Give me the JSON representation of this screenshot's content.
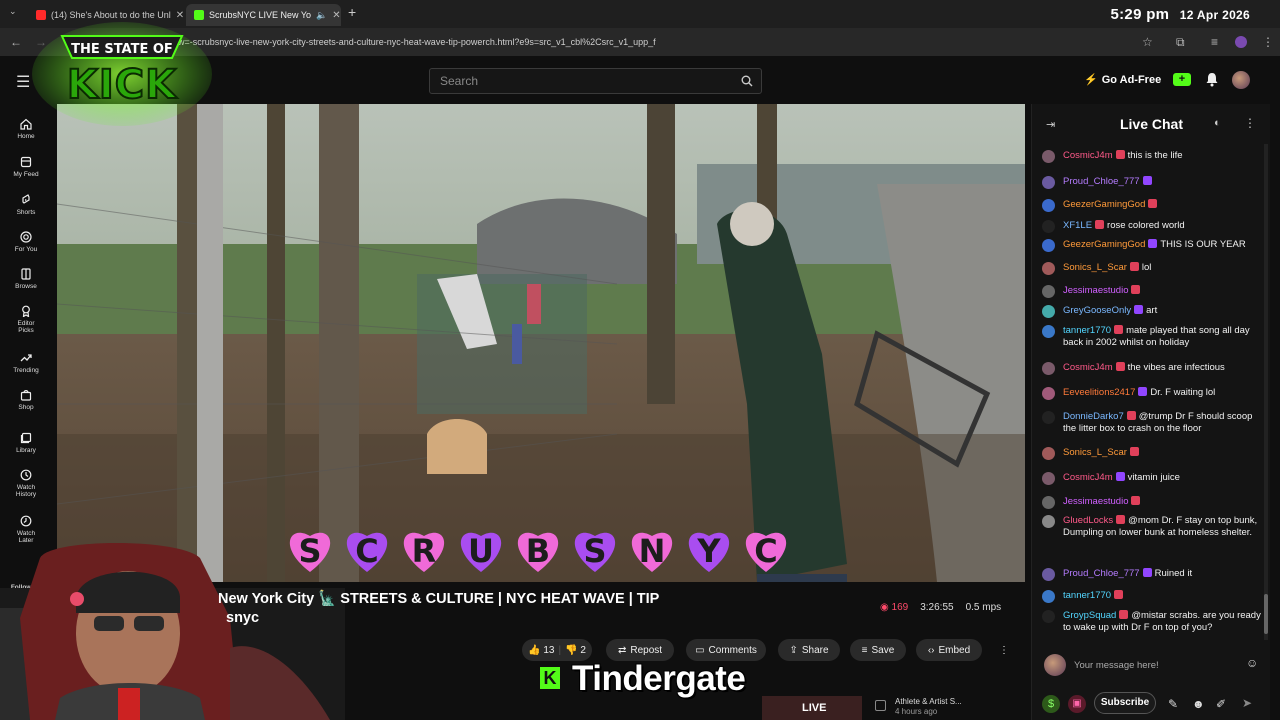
{
  "browser": {
    "tabs": [
      {
        "title": "(14) She's About to do the Unl",
        "favicon_color": "#ff2a2a"
      },
      {
        "title": "ScrubsNYC LIVE New Yo",
        "favicon_color": "#53fc18"
      }
    ],
    "clock_time": "5:29 pm",
    "clock_date": "12 Apr 2026",
    "url": "rw=-scrubsnyc-live-new-york-city-streets-and-culture-nyc-heat-wave-tip-powerch.html?e9s=src_v1_cbl%2Csrc_v1_upp_f"
  },
  "header": {
    "search_placeholder": "Search",
    "go_ad_free": "Go Ad-Free",
    "logo_line1": "THE STATE OF",
    "logo_line2": "KICK"
  },
  "sidebar": {
    "items": [
      {
        "label": "Home",
        "icon": "home-icon"
      },
      {
        "label": "My Feed",
        "icon": "feed-icon"
      },
      {
        "label": "Shorts",
        "icon": "shorts-icon"
      },
      {
        "label": "For You",
        "icon": "target-icon"
      },
      {
        "label": "Browse",
        "icon": "browse-icon"
      },
      {
        "label": "Editor Picks",
        "icon": "award-icon"
      },
      {
        "label": "Trending",
        "icon": "trending-icon"
      },
      {
        "label": "Shop",
        "icon": "shop-icon"
      },
      {
        "label": "Library",
        "icon": "library-icon"
      },
      {
        "label": "Watch History",
        "icon": "history-icon"
      },
      {
        "label": "Watch Later",
        "icon": "clock-icon"
      }
    ],
    "following_label": "Following"
  },
  "video": {
    "overlay_text": "SCRUBSNYC",
    "title_line1": "New York City 🗽 STREETS & CULTURE | NYC HEAT WAVE | TIP",
    "title_line2": "snyc",
    "viewers": "169",
    "duration": "3:26:55",
    "bitrate": "0.5 mps",
    "likes": "13",
    "dislikes": "2",
    "actions": [
      "Repost",
      "Comments",
      "Share",
      "Save",
      "Embed"
    ],
    "ticker_text": "Tindergate",
    "suggestion_title": "Athlete & Artist S...",
    "suggestion_time": "4 hours ago"
  },
  "chat": {
    "title": "Live Chat",
    "input_placeholder": "Your message here!",
    "subscribe_label": "Subscribe",
    "messages": [
      {
        "user": "CosmicJ4m",
        "color": "#ff5a8a",
        "text": "this is the life",
        "avatar": "#7a5a6a"
      },
      {
        "user": "Proud_Chloe_777",
        "color": "#b57cff",
        "text": "",
        "avatar": "#6a5aa0"
      },
      {
        "user": "GeezerGamingGod",
        "color": "#ff9a3a",
        "text": "",
        "avatar": "#3a6acc"
      },
      {
        "user": "XF1LE",
        "color": "#7ab8ff",
        "text": "rose colored world",
        "avatar": "#222"
      },
      {
        "user": "GeezerGamingGod",
        "color": "#ff9a3a",
        "text": "THIS IS OUR YEAR",
        "avatar": "#3a6acc"
      },
      {
        "user": "Sonics_L_Scar",
        "color": "#ff9a3a",
        "text": "lol",
        "avatar": "#a05a5a"
      },
      {
        "user": "Jessimaestudio",
        "color": "#d060ff",
        "text": "",
        "avatar": "#666"
      },
      {
        "user": "GreyGooseOnly",
        "color": "#7ab8ff",
        "text": "art",
        "avatar": "#4aa"
      },
      {
        "user": "tanner1770",
        "color": "#53d6ff",
        "text": "mate played that song all day back in 2002 whilst on holiday",
        "avatar": "#3a78c8"
      },
      {
        "user": "CosmicJ4m",
        "color": "#ff5a8a",
        "text": "the vibes are infectious",
        "avatar": "#7a5a6a"
      },
      {
        "user": "Eeveelitions2417",
        "color": "#ff7a3a",
        "text": "Dr. F waiting lol",
        "avatar": "#a05a7a"
      },
      {
        "user": "DonnieDarko7",
        "color": "#7ab8ff",
        "text": "@trump Dr F should scoop the litter box to crash on the floor",
        "avatar": "#222"
      },
      {
        "user": "Sonics_L_Scar",
        "color": "#ff9a3a",
        "text": "",
        "avatar": "#a05a5a"
      },
      {
        "user": "CosmicJ4m",
        "color": "#ff5a8a",
        "text": "vitamin juice",
        "avatar": "#7a5a6a"
      },
      {
        "user": "Jessimaestudio",
        "color": "#d060ff",
        "text": "",
        "avatar": "#666"
      },
      {
        "user": "GluedLocks",
        "color": "#ff5a8a",
        "text": "@mom Dr. F stay on top bunk, Dumpling on lower bunk at homeless shelter.",
        "avatar": "#888"
      },
      {
        "user": "Proud_Chloe_777",
        "color": "#b57cff",
        "text": "Ruined it",
        "avatar": "#6a5aa0"
      },
      {
        "user": "tanner1770",
        "color": "#53d6ff",
        "text": "",
        "avatar": "#3a78c8"
      },
      {
        "user": "GroypSquad",
        "color": "#53d6ff",
        "text": "@mistar scrabs. are you ready to wake up with Dr F on top of you?",
        "avatar": "#222"
      }
    ]
  },
  "colors": {
    "kick_green": "#53fc18",
    "overlay_pink": "#f06ad8",
    "overlay_purple": "#a94df0"
  }
}
